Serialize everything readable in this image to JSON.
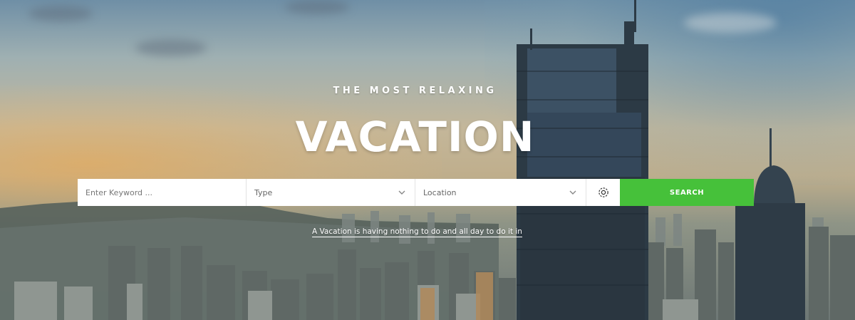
{
  "hero": {
    "eyebrow": "THE MOST RELAXING",
    "title": "VACATION",
    "tagline": "A Vacation is having nothing to do and all day to do it in"
  },
  "search": {
    "keyword_placeholder": "Enter Keyword ...",
    "type_label": "Type",
    "location_label": "Location",
    "button_label": "SEARCH",
    "button_color": "#46c13a"
  },
  "icons": {
    "type_dropdown": "chevron-down-icon",
    "location_dropdown": "chevron-down-icon",
    "settings": "gear-icon"
  }
}
